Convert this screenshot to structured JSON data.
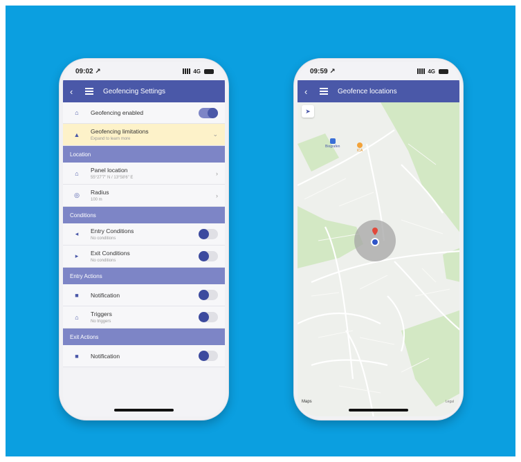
{
  "left_phone": {
    "status": {
      "time": "09:02 ↗",
      "network": "4G"
    },
    "appbar": {
      "back_icon": "chevron-left-icon",
      "menu_icon": "menu-icon",
      "title": "Geofencing Settings"
    },
    "rows_top": [
      {
        "icon": "home-icon",
        "label": "Geofencing enabled",
        "toggle": true
      },
      {
        "icon": "warning-icon",
        "label": "Geofencing limitations",
        "sub": "Expand to learn more",
        "chevron": "⌄"
      }
    ],
    "sections": {
      "location": "Location",
      "conditions": "Conditions",
      "entry_actions": "Entry Actions",
      "exit_actions": "Exit Actions"
    },
    "location_rows": [
      {
        "icon": "house-icon",
        "label": "Panel location",
        "sub": "55°27'7\" N / 13°58'6\" E"
      },
      {
        "icon": "radius-icon",
        "label": "Radius",
        "sub": "100 m"
      }
    ],
    "conditions_rows": [
      {
        "icon": "entry-icon",
        "label": "Entry Conditions",
        "sub": "No conditions",
        "toggle": false
      },
      {
        "icon": "exit-icon",
        "label": "Exit Conditions",
        "sub": "No conditions",
        "toggle": false
      }
    ],
    "entry_rows": [
      {
        "icon": "notification-icon",
        "label": "Notification",
        "toggle": false
      },
      {
        "icon": "trigger-icon",
        "label": "Triggers",
        "sub": "No triggers",
        "toggle": false
      }
    ],
    "exit_rows": [
      {
        "icon": "notification-icon",
        "label": "Notification",
        "toggle": false
      }
    ]
  },
  "right_phone": {
    "status": {
      "time": "09:59 ↗",
      "network": "4G"
    },
    "appbar": {
      "back_icon": "chevron-left-icon",
      "menu_icon": "menu-icon",
      "title": "Geofence locations"
    },
    "map": {
      "locate_icon": "navigation-arrow-icon",
      "poi_blue": "Biografen",
      "poi_orange": "ICA",
      "credit": "Maps",
      "legal": "Legal"
    }
  },
  "colors": {
    "background": "#0b9fe0",
    "primary": "#4a58a8",
    "section": "#7d85c6",
    "warning": "#fdf2c9"
  }
}
